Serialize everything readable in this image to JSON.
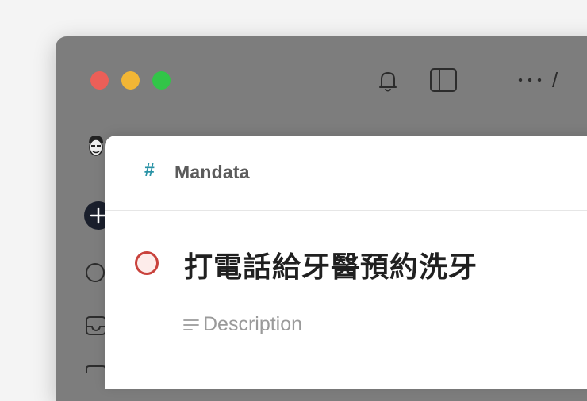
{
  "window": {
    "toolbar": {
      "bell_icon": "bell-icon",
      "sidebar_icon": "sidebar-toggle-icon",
      "more_icon": "ellipsis-icon",
      "separator": "/"
    },
    "sidebar": {
      "avatar_icon": "avatar-icon",
      "add_icon": "plus-icon",
      "nav_icons": [
        "circle-icon",
        "inbox-icon"
      ]
    }
  },
  "task_modal": {
    "project": {
      "icon": "#",
      "name": "Mandata",
      "icon_color": "#2a93a6"
    },
    "task": {
      "title": "打電話給牙醫預約洗牙",
      "priority_color": "#c9423c"
    },
    "description": {
      "placeholder": "Description"
    }
  }
}
